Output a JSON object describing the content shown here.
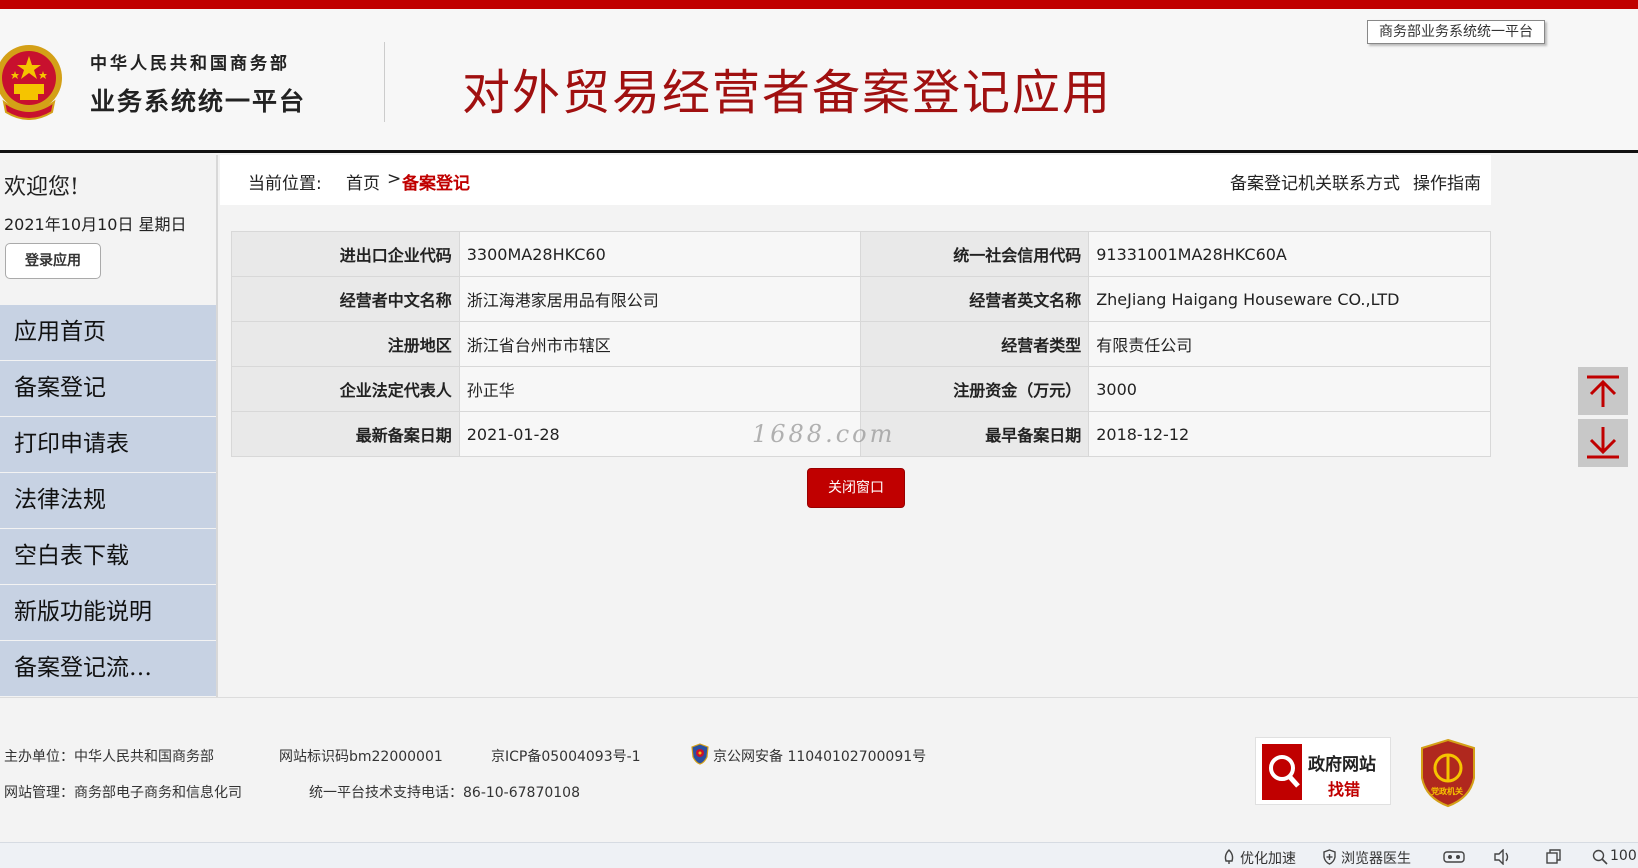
{
  "header": {
    "org_line1": "中华人民共和国商务部",
    "org_line2": "业务系统统一平台",
    "app_title": "对外贸易经营者备案登记应用",
    "platform_tag": "商务部业务系统统一平台"
  },
  "sidebar": {
    "welcome": "欢迎您!",
    "date": "2021年10月10日 星期日",
    "login_label": "登录应用",
    "items": [
      {
        "label": "应用首页"
      },
      {
        "label": "备案登记"
      },
      {
        "label": "打印申请表"
      },
      {
        "label": "法律法规"
      },
      {
        "label": "空白表下载"
      },
      {
        "label": "新版功能说明"
      },
      {
        "label": "备案登记流…"
      }
    ]
  },
  "breadcrumb": {
    "label": "当前位置:",
    "home": "首页",
    "separator": ">",
    "current": "备案登记",
    "contact_link": "备案登记机关联系方式",
    "guide_link": "操作指南"
  },
  "info_table": {
    "rows": [
      {
        "label1": "进出口企业代码",
        "value1": "3300MA28HKC60",
        "label2": "统一社会信用代码",
        "value2": "91331001MA28HKC60A"
      },
      {
        "label1": "经营者中文名称",
        "value1": "浙江海港家居用品有限公司",
        "label2": "经营者英文名称",
        "value2": "ZheJiang Haigang Houseware CO.,LTD"
      },
      {
        "label1": "注册地区",
        "value1": "浙江省台州市市辖区",
        "label2": "经营者类型",
        "value2": "有限责任公司"
      },
      {
        "label1": "企业法定代表人",
        "value1": "孙正华",
        "label2": "注册资金（万元）",
        "value2": "3000"
      },
      {
        "label1": "最新备案日期",
        "value1": "2021-01-28",
        "label2": "最早备案日期",
        "value2": "2018-12-12"
      }
    ]
  },
  "watermark": "1688.com",
  "close_button": "关闭窗口",
  "footer": {
    "host": "主办单位：中华人民共和国商务部",
    "site_id": "网站标识码bm22000001",
    "icp": "京ICP备05004093号-1",
    "police": "京公网安备 11040102700091号",
    "admin": "网站管理：商务部电子商务和信息化司",
    "support": "统一平台技术支持电话：86-10-67870108",
    "gov_badge_line1": "政府网站",
    "gov_badge_line2": "找错",
    "party_badge_text": "党政机关"
  },
  "statusbar": {
    "accelerate": "优化加速",
    "doctor": "浏览器医生",
    "zoom": "100"
  },
  "colors": {
    "brand_red": "#c00000",
    "nav_bg": "#c7d2e3",
    "title_red": "#a01010"
  }
}
